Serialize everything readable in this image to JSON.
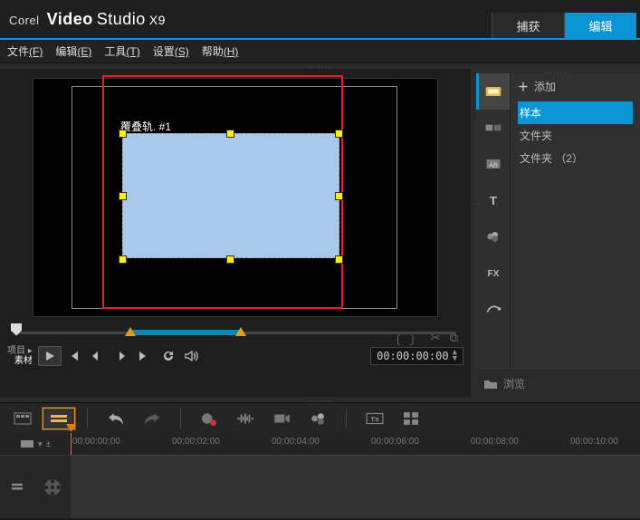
{
  "brand": {
    "corel": "Corel",
    "video": "Video",
    "studio": "Studio",
    "ver": "X9"
  },
  "mainTabs": {
    "capture": "捕获",
    "edit": "编辑"
  },
  "menu": {
    "file": "文件",
    "file_k": "(F)",
    "edit": "编辑",
    "edit_k": "(E)",
    "tools": "工具",
    "tools_k": "(T)",
    "settings": "设置",
    "settings_k": "(S)",
    "help": "帮助",
    "help_k": "(H)"
  },
  "preview": {
    "overlayLabel": "覆叠轨. #1",
    "modeProject": "项目",
    "modeClip": "素材",
    "timecode": "00:00:00:00"
  },
  "library": {
    "add": "添加",
    "items": [
      "样本",
      "文件夹",
      "文件夹 （2）"
    ],
    "browse": "浏览"
  },
  "timeline": {
    "ticks": [
      "00:00:00:00",
      "00:00:02:00",
      "00:00:04:00",
      "00:00:06:00",
      "00:00:08:00",
      "00:00:10:00"
    ]
  }
}
